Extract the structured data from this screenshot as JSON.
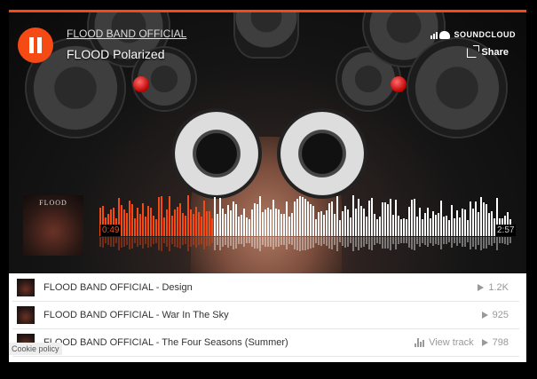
{
  "player": {
    "artist": "FLOOD BAND OFFICIAL",
    "title": "FLOOD Polarized",
    "brand": "SOUNDCLOUD",
    "share_label": "Share",
    "current_time": "0:49",
    "duration": "2:57",
    "progress": 0.277,
    "artwork_label": "FLOOD",
    "accent_color": "#f64a14",
    "state": "playing"
  },
  "tracklist": [
    {
      "title": "FLOOD BAND OFFICIAL - Design",
      "plays": "1.2K",
      "view_track": ""
    },
    {
      "title": "FLOOD BAND OFFICIAL - War In The Sky",
      "plays": "925",
      "view_track": ""
    },
    {
      "title": "FLOOD BAND OFFICIAL - The Four Seasons (Summer)",
      "plays": "798",
      "view_track": "View track"
    }
  ],
  "cookie_policy": "Cookie policy",
  "icons": [
    "pause-icon",
    "soundcloud-logo-icon",
    "share-icon",
    "play-count-icon",
    "waveform-icon"
  ]
}
